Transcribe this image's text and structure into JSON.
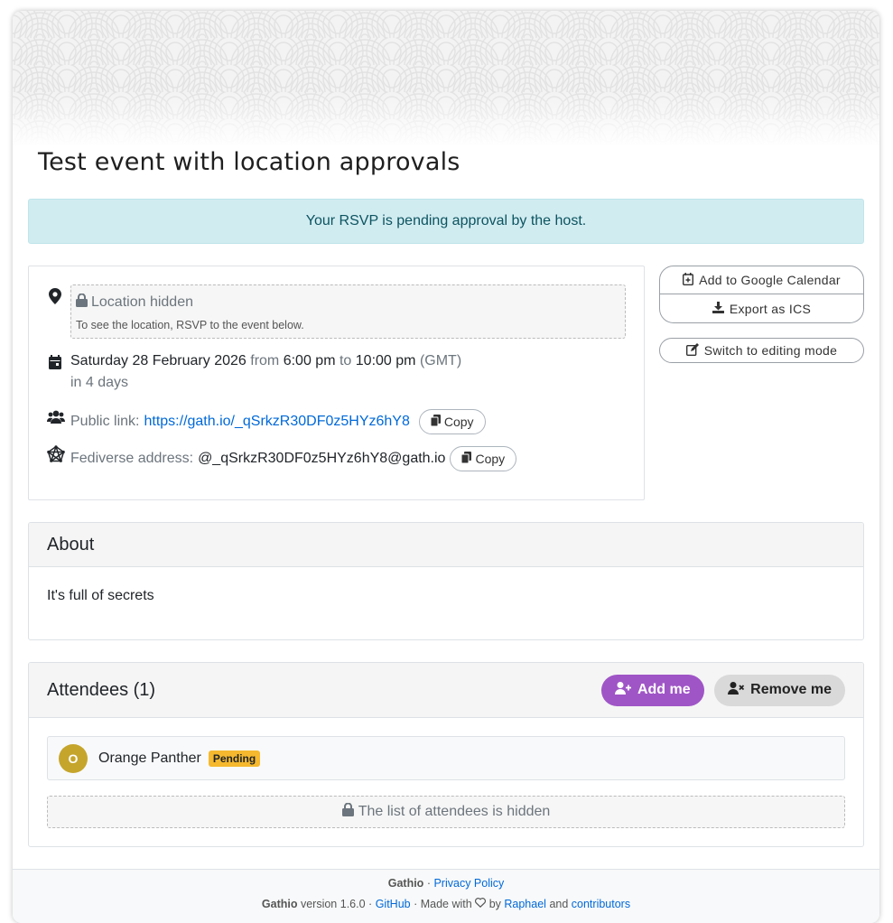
{
  "event": {
    "title": "Test event with location approvals"
  },
  "alert": {
    "message": "Your RSVP is pending approval by the host."
  },
  "location": {
    "title": "Location hidden",
    "note": "To see the location, RSVP to the event below."
  },
  "datetime": {
    "date": "Saturday 28 February 2026",
    "from_word": "from",
    "start": "6:00 pm",
    "to_word": "to",
    "end": "10:00 pm",
    "timezone": "(GMT)",
    "relative": "in 4 days"
  },
  "public_link": {
    "label": "Public link:",
    "url": "https://gath.io/_qSrkzR30DF0z5HYz6hY8",
    "copy_label": "Copy"
  },
  "fediverse": {
    "label": "Fediverse address:",
    "address": "@_qSrkzR30DF0z5HYz6hY8@gath.io",
    "copy_label": "Copy"
  },
  "sidebar": {
    "google_calendar_label": "Add to Google Calendar",
    "export_ics_label": "Export as ICS",
    "edit_mode_label": "Switch to editing mode"
  },
  "about": {
    "heading": "About",
    "body": "It's full of secrets"
  },
  "attendees": {
    "heading": "Attendees (1)",
    "add_label": "Add me",
    "remove_label": "Remove me",
    "list": [
      {
        "initial": "O",
        "name": "Orange Panther",
        "status": "Pending"
      }
    ],
    "hidden_note": "The list of attendees is hidden"
  },
  "footer": {
    "brand": "Gathio",
    "separator": "·",
    "privacy_label": "Privacy Policy",
    "version_text": "version 1.6.0",
    "github_label": "GitHub",
    "made_with": "Made with",
    "by": "by",
    "author": "Raphael",
    "and": "and",
    "contributors": "contributors"
  },
  "colors": {
    "accent": "#9f55c6",
    "alert_bg": "#d1ecf1",
    "badge": "#f5b82e",
    "avatar": "#c5a52b",
    "link": "#0069d9"
  },
  "icons": {
    "location": "map-marker-icon",
    "lock": "lock-icon",
    "date": "calendar-icon",
    "public_link": "users-icon",
    "fediverse": "fediverse-icon",
    "copy": "copy-icon",
    "calendar_plus": "calendar-plus-icon",
    "download": "download-icon",
    "edit": "edit-icon",
    "user_plus": "user-plus-icon",
    "user_times": "user-times-icon",
    "heart": "heart-icon"
  }
}
